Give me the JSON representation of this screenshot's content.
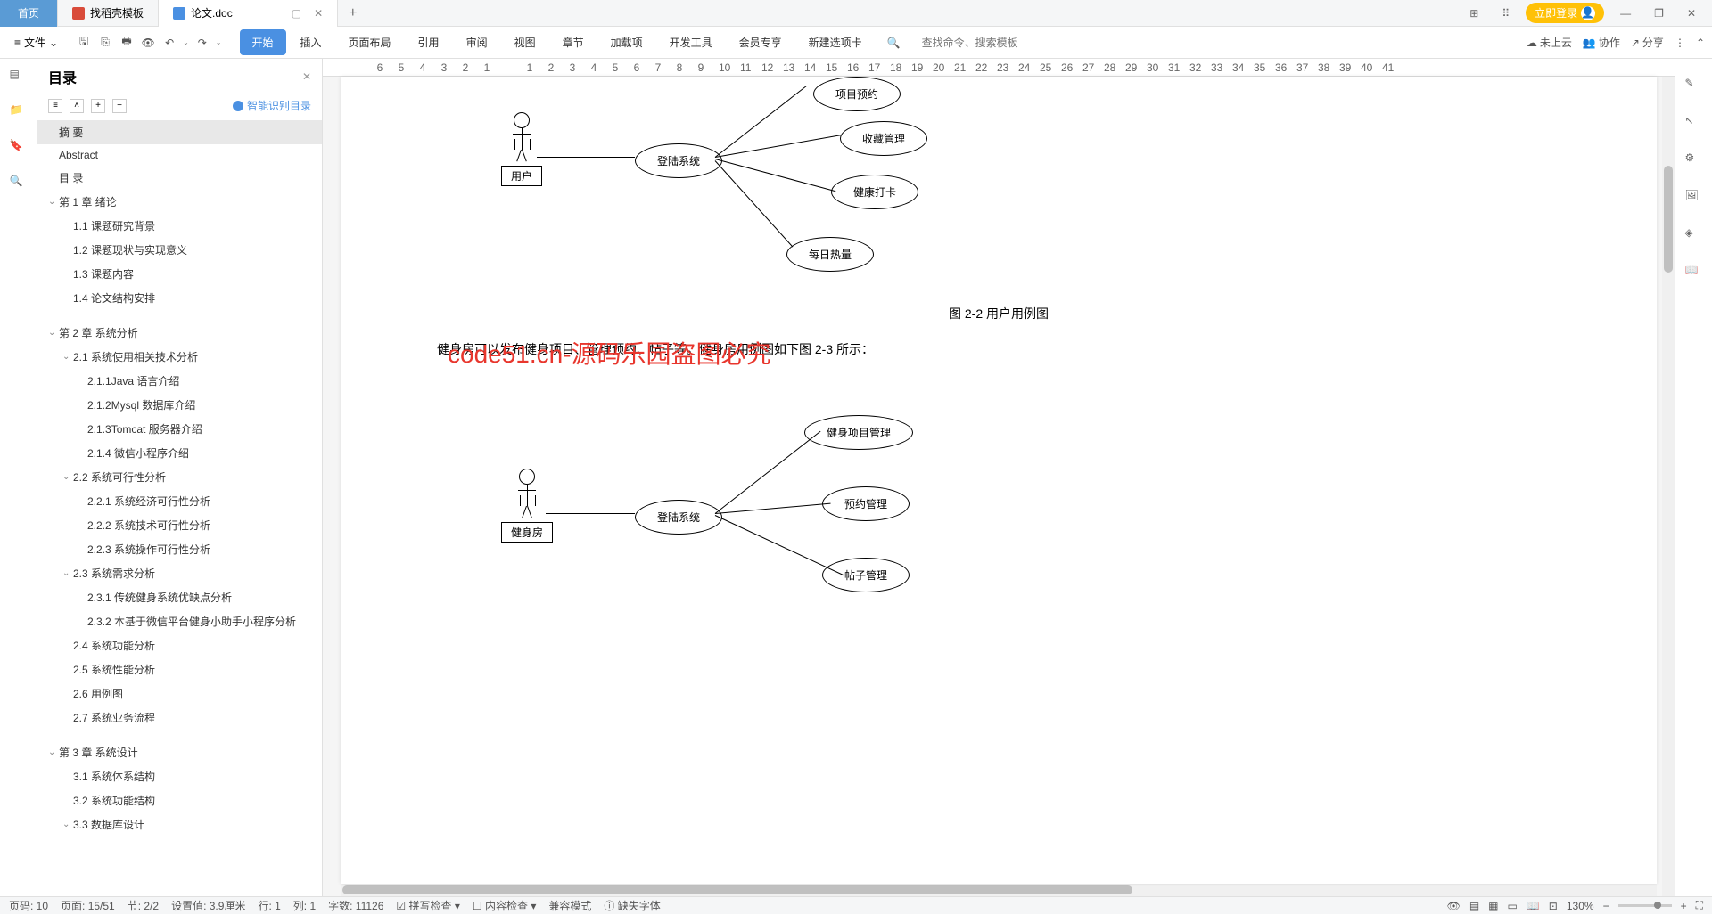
{
  "tabs": {
    "home": "首页",
    "template": "找稻壳模板",
    "doc": "论文.doc"
  },
  "login": "立即登录",
  "file_menu": "文件",
  "menu": {
    "start": "开始",
    "insert": "插入",
    "layout": "页面布局",
    "ref": "引用",
    "review": "审阅",
    "view": "视图",
    "chapter": "章节",
    "addon": "加载项",
    "dev": "开发工具",
    "vip": "会员专享",
    "newtab": "新建选项卡"
  },
  "search_ph": "查找命令、搜索模板",
  "cloud": "未上云",
  "collab": "协作",
  "share": "分享",
  "outline": {
    "title": "目录",
    "smart": "智能识别目录"
  },
  "toc": [
    {
      "t": "摘  要",
      "l": 0,
      "sel": true
    },
    {
      "t": "Abstract",
      "l": 0
    },
    {
      "t": "目  录",
      "l": 0
    },
    {
      "t": "第 1 章   绪论",
      "l": 0,
      "a": true
    },
    {
      "t": "1.1 课题研究背景",
      "l": 1
    },
    {
      "t": "1.2 课题现状与实现意义",
      "l": 1
    },
    {
      "t": "1.3 课题内容",
      "l": 1
    },
    {
      "t": "1.4 论文结构安排",
      "l": 1
    },
    {
      "t": "第 2 章   系统分析",
      "l": 0,
      "a": true,
      "gap": true
    },
    {
      "t": "2.1 系统使用相关技术分析",
      "l": 1,
      "a": true
    },
    {
      "t": "2.1.1Java 语言介绍",
      "l": 2
    },
    {
      "t": "2.1.2Mysql 数据库介绍",
      "l": 2
    },
    {
      "t": "2.1.3Tomcat 服务器介绍",
      "l": 2
    },
    {
      "t": "2.1.4 微信小程序介绍",
      "l": 2
    },
    {
      "t": "2.2 系统可行性分析",
      "l": 1,
      "a": true
    },
    {
      "t": "2.2.1 系统经济可行性分析",
      "l": 2
    },
    {
      "t": "2.2.2 系统技术可行性分析",
      "l": 2
    },
    {
      "t": "2.2.3 系统操作可行性分析",
      "l": 2
    },
    {
      "t": "2.3 系统需求分析",
      "l": 1,
      "a": true
    },
    {
      "t": "2.3.1 传统健身系统优缺点分析",
      "l": 2
    },
    {
      "t": "2.3.2 本基于微信平台健身小助手小程序分析",
      "l": 2
    },
    {
      "t": "2.4 系统功能分析",
      "l": 1
    },
    {
      "t": "2.5 系统性能分析",
      "l": 1
    },
    {
      "t": "2.6 用例图",
      "l": 1
    },
    {
      "t": "2.7 系统业务流程",
      "l": 1
    },
    {
      "t": "第 3 章   系统设计",
      "l": 0,
      "a": true,
      "gap": true
    },
    {
      "t": "3.1 系统体系结构",
      "l": 1
    },
    {
      "t": "3.2 系统功能结构",
      "l": 1
    },
    {
      "t": "3.3 数据库设计",
      "l": 1,
      "a": true
    }
  ],
  "ruler": [
    "6",
    "5",
    "4",
    "3",
    "2",
    "1",
    "",
    "1",
    "2",
    "3",
    "4",
    "5",
    "6",
    "7",
    "8",
    "9",
    "10",
    "11",
    "12",
    "13",
    "14",
    "15",
    "16",
    "17",
    "18",
    "19",
    "20",
    "21",
    "22",
    "23",
    "24",
    "25",
    "26",
    "27",
    "28",
    "29",
    "30",
    "31",
    "32",
    "33",
    "34",
    "35",
    "36",
    "37",
    "38",
    "39",
    "40",
    "41"
  ],
  "doc": {
    "uc_top": {
      "actor": "用户",
      "system": "登陆系统",
      "u1": "项目预约",
      "u2": "收藏管理",
      "u3": "健康打卡",
      "u4": "每日热量"
    },
    "caption1": "图 2-2 用户用例图",
    "para": "健身房可以发布健身项目、管理预约、帖子等。健身房用例图如下图 2-3 所示：",
    "uc_bot": {
      "actor": "健身房",
      "system": "登陆系统",
      "u1": "健身项目管理",
      "u2": "预约管理",
      "u3": "帖子管理"
    }
  },
  "watermark": "code51.cn-源码乐园盗图必究",
  "status": {
    "page": "页码: 10",
    "pages": "页面: 15/51",
    "section": "节: 2/2",
    "setval": "设置值: 3.9厘米",
    "row": "行: 1",
    "col": "列: 1",
    "words": "字数: 11126",
    "spell": "拼写检查",
    "content": "内容检查",
    "compat": "兼容模式",
    "font": "缺失字体",
    "zoom": "130%"
  }
}
